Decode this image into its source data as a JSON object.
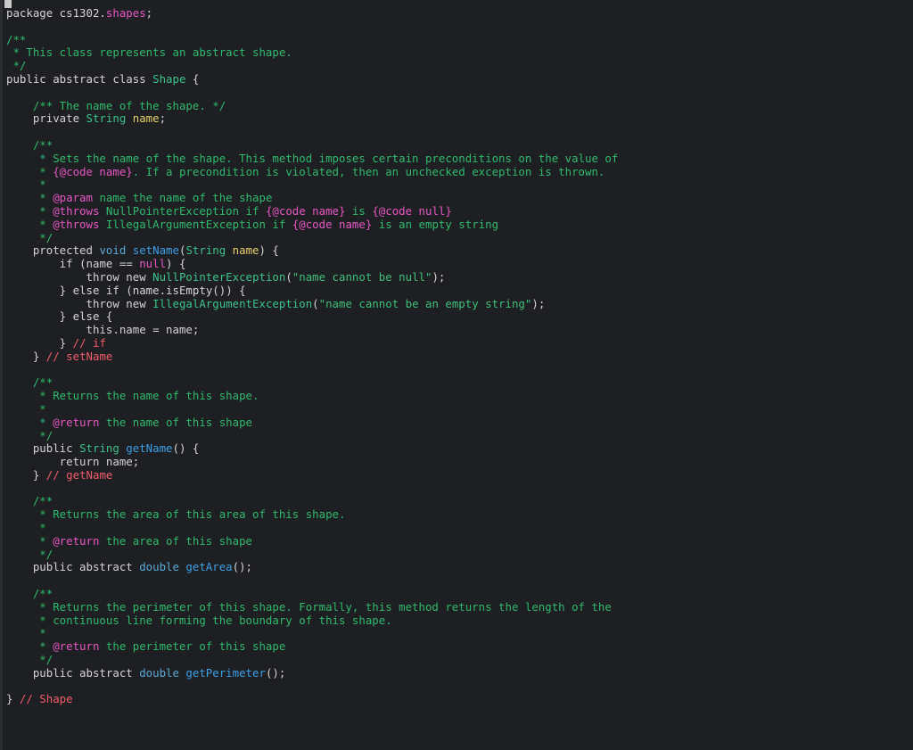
{
  "lines": [
    [
      [
        "def",
        "package cs1302."
      ],
      [
        "pkg",
        "shapes"
      ],
      [
        "def",
        ";"
      ]
    ],
    [],
    [
      [
        "cmt",
        "/**"
      ]
    ],
    [
      [
        "cmt",
        " * This class represents an abstract shape."
      ]
    ],
    [
      [
        "cmt",
        " */"
      ]
    ],
    [
      [
        "kw",
        "public abstract class "
      ],
      [
        "typ",
        "Shape"
      ],
      [
        "def",
        " {"
      ]
    ],
    [],
    [
      [
        "cmt",
        "    /** The name of the shape. */"
      ]
    ],
    [
      [
        "kw",
        "    private "
      ],
      [
        "typ",
        "String "
      ],
      [
        "var",
        "name"
      ],
      [
        "def",
        ";"
      ]
    ],
    [],
    [
      [
        "cmt",
        "    /**"
      ]
    ],
    [
      [
        "cmt",
        "     * Sets the name of the shape. This method imposes certain preconditions on the value of"
      ]
    ],
    [
      [
        "cmt",
        "     * "
      ],
      [
        "tag",
        "{@code name}"
      ],
      [
        "cmt",
        ". If a precondition is violated, then an unchecked exception is thrown."
      ]
    ],
    [
      [
        "cmt",
        "     *"
      ]
    ],
    [
      [
        "cmt",
        "     * "
      ],
      [
        "tag",
        "@param"
      ],
      [
        "cmt",
        " name the name of the shape"
      ]
    ],
    [
      [
        "cmt",
        "     * "
      ],
      [
        "tag",
        "@throws"
      ],
      [
        "cmt",
        " NullPointerException if "
      ],
      [
        "tag",
        "{@code name}"
      ],
      [
        "cmt",
        " is "
      ],
      [
        "tag",
        "{@code null}"
      ]
    ],
    [
      [
        "cmt",
        "     * "
      ],
      [
        "tag",
        "@throws"
      ],
      [
        "cmt",
        " IllegalArgumentException if "
      ],
      [
        "tag",
        "{@code name}"
      ],
      [
        "cmt",
        " is an empty string"
      ]
    ],
    [
      [
        "cmt",
        "     */"
      ]
    ],
    [
      [
        "kw",
        "    protected "
      ],
      [
        "void",
        "void "
      ],
      [
        "fn",
        "setName"
      ],
      [
        "def",
        "("
      ],
      [
        "typ",
        "String "
      ],
      [
        "var",
        "name"
      ],
      [
        "def",
        ") {"
      ]
    ],
    [
      [
        "kw",
        "        if "
      ],
      [
        "def",
        "(name == "
      ],
      [
        "lit",
        "null"
      ],
      [
        "def",
        ") {"
      ]
    ],
    [
      [
        "kw",
        "            throw new "
      ],
      [
        "typ",
        "NullPointerException"
      ],
      [
        "def",
        "("
      ],
      [
        "str",
        "\"name cannot be null\""
      ],
      [
        "def",
        ");"
      ]
    ],
    [
      [
        "def",
        "        } "
      ],
      [
        "kw",
        "else if "
      ],
      [
        "def",
        "(name.isEmpty()) {"
      ]
    ],
    [
      [
        "kw",
        "            throw new "
      ],
      [
        "typ",
        "IllegalArgumentException"
      ],
      [
        "def",
        "("
      ],
      [
        "str",
        "\"name cannot be an empty string\""
      ],
      [
        "def",
        ");"
      ]
    ],
    [
      [
        "def",
        "        } "
      ],
      [
        "kw",
        "else "
      ],
      [
        "def",
        "{"
      ]
    ],
    [
      [
        "kw",
        "            this"
      ],
      [
        "def",
        ".name = name;"
      ]
    ],
    [
      [
        "def",
        "        } "
      ],
      [
        "ecmt",
        "// if"
      ]
    ],
    [
      [
        "def",
        "    } "
      ],
      [
        "ecmt",
        "// setName"
      ]
    ],
    [],
    [
      [
        "cmt",
        "    /**"
      ]
    ],
    [
      [
        "cmt",
        "     * Returns the name of this shape."
      ]
    ],
    [
      [
        "cmt",
        "     *"
      ]
    ],
    [
      [
        "cmt",
        "     * "
      ],
      [
        "tag",
        "@return"
      ],
      [
        "cmt",
        " the name of this shape"
      ]
    ],
    [
      [
        "cmt",
        "     */"
      ]
    ],
    [
      [
        "kw",
        "    public "
      ],
      [
        "typ",
        "String "
      ],
      [
        "fn",
        "getName"
      ],
      [
        "def",
        "() {"
      ]
    ],
    [
      [
        "kw",
        "        return "
      ],
      [
        "def",
        "name;"
      ]
    ],
    [
      [
        "def",
        "    } "
      ],
      [
        "ecmt",
        "// getName"
      ]
    ],
    [],
    [
      [
        "cmt",
        "    /**"
      ]
    ],
    [
      [
        "cmt",
        "     * Returns the area of this area of this shape."
      ]
    ],
    [
      [
        "cmt",
        "     *"
      ]
    ],
    [
      [
        "cmt",
        "     * "
      ],
      [
        "tag",
        "@return"
      ],
      [
        "cmt",
        " the area of this shape"
      ]
    ],
    [
      [
        "cmt",
        "     */"
      ]
    ],
    [
      [
        "kw",
        "    public abstract "
      ],
      [
        "void",
        "double "
      ],
      [
        "fn",
        "getArea"
      ],
      [
        "def",
        "();"
      ]
    ],
    [],
    [
      [
        "cmt",
        "    /**"
      ]
    ],
    [
      [
        "cmt",
        "     * Returns the perimeter of this shape. Formally, this method returns the length of the"
      ]
    ],
    [
      [
        "cmt",
        "     * continuous line forming the boundary of this shape."
      ]
    ],
    [
      [
        "cmt",
        "     *"
      ]
    ],
    [
      [
        "cmt",
        "     * "
      ],
      [
        "tag",
        "@return"
      ],
      [
        "cmt",
        " the perimeter of this shape"
      ]
    ],
    [
      [
        "cmt",
        "     */"
      ]
    ],
    [
      [
        "kw",
        "    public abstract "
      ],
      [
        "void",
        "double "
      ],
      [
        "fn",
        "getPerimeter"
      ],
      [
        "def",
        "();"
      ]
    ],
    [],
    [
      [
        "def",
        "} "
      ],
      [
        "ecmt",
        "// Shape"
      ]
    ]
  ]
}
